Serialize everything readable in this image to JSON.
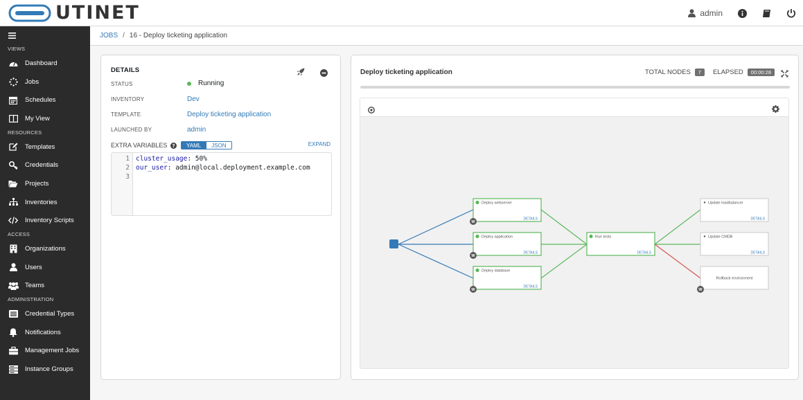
{
  "app": {
    "logo_text": "UTINET",
    "user": "admin"
  },
  "icons": {
    "user": "user-icon",
    "info": "info-circle-icon",
    "docs": "book-icon",
    "logout": "power-icon",
    "menu": "hamburger-icon",
    "launch": "rocket-icon",
    "cancel": "minus-circle-icon",
    "help": "question-circle-icon",
    "fullscreen": "expand-arrows-icon",
    "zoom": "compass-icon",
    "settings": "gear-icon"
  },
  "sidebar": {
    "sections": [
      {
        "title": "VIEWS",
        "items": [
          {
            "label": "Dashboard",
            "icon": "dashboard-icon"
          },
          {
            "label": "Jobs",
            "icon": "spinner-icon"
          },
          {
            "label": "Schedules",
            "icon": "calendar-icon"
          },
          {
            "label": "My View",
            "icon": "columns-icon"
          }
        ]
      },
      {
        "title": "RESOURCES",
        "items": [
          {
            "label": "Templates",
            "icon": "edit-icon"
          },
          {
            "label": "Credentials",
            "icon": "key-icon"
          },
          {
            "label": "Projects",
            "icon": "folder-open-icon"
          },
          {
            "label": "Inventories",
            "icon": "sitemap-icon"
          },
          {
            "label": "Inventory Scripts",
            "icon": "code-icon"
          }
        ]
      },
      {
        "title": "ACCESS",
        "items": [
          {
            "label": "Organizations",
            "icon": "building-icon"
          },
          {
            "label": "Users",
            "icon": "user-icon"
          },
          {
            "label": "Teams",
            "icon": "users-icon"
          }
        ]
      },
      {
        "title": "ADMINISTRATION",
        "items": [
          {
            "label": "Credential Types",
            "icon": "list-alt-icon"
          },
          {
            "label": "Notifications",
            "icon": "bell-icon"
          },
          {
            "label": "Management Jobs",
            "icon": "briefcase-icon"
          },
          {
            "label": "Instance Groups",
            "icon": "server-icon"
          }
        ]
      }
    ]
  },
  "breadcrumb": {
    "root": "JOBS",
    "separator": "/",
    "current": "16 - Deploy ticketing application"
  },
  "details": {
    "title": "DETAILS",
    "status_label": "STATUS",
    "status": "Running",
    "status_color": "#5cb85c",
    "inventory_label": "INVENTORY",
    "inventory": "Dev",
    "template_label": "TEMPLATE",
    "template": "Deploy ticketing application",
    "launched_label": "LAUNCHED BY",
    "launched_by": "admin",
    "extra_vars_label": "EXTRA VARIABLES",
    "yaml": "YAML",
    "json": "JSON",
    "expand": "EXPAND",
    "code": [
      {
        "n": "1",
        "key": "cluster_usage",
        "rest": ": 50%"
      },
      {
        "n": "2",
        "key": "our_user",
        "rest": ": admin@local.deployment.example.com"
      },
      {
        "n": "3",
        "key": "",
        "rest": ""
      }
    ]
  },
  "workflow": {
    "title": "Deploy ticketing application",
    "total_nodes_label": "TOTAL NODES",
    "total_nodes": "7",
    "elapsed_label": "ELAPSED",
    "elapsed": "00:00:28",
    "details_link": "DETAILS",
    "node_badge": "W",
    "nodes": {
      "webserver": "Deploy webserver",
      "application": "Deploy application",
      "database": "Deploy database",
      "tests": "Run tests",
      "loadbalancer": "Update loadbalancer",
      "cmdb": "Update CMDB",
      "rollback": "Rollback environment"
    },
    "colors": {
      "success": "#5cb85c",
      "failure": "#d9534f",
      "always": "#337ab7",
      "start": "#337ab7"
    }
  }
}
